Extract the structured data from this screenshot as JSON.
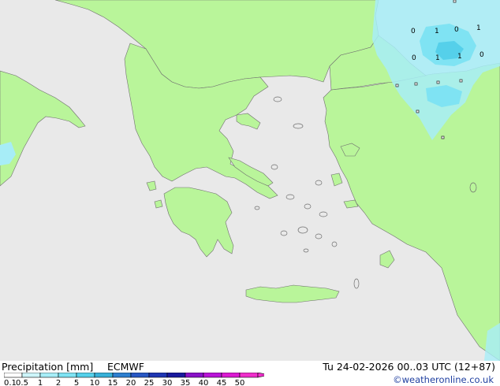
{
  "header": {
    "title": "Precipitation [mm]",
    "model": "ECMWF",
    "run": "Tu 24-02-2026 00..03 UTC (12+87)",
    "credit": "©weatheronline.co.uk"
  },
  "legend": {
    "ticks": [
      "0.1",
      "0.5",
      "1",
      "2",
      "5",
      "10",
      "15",
      "20",
      "25",
      "30",
      "35",
      "40",
      "45",
      "50"
    ],
    "colors": [
      "#ffffff",
      "#cdf5fa",
      "#a7edf7",
      "#7fe3f3",
      "#55d0ea",
      "#37b0d8",
      "#2d7fd0",
      "#2858c4",
      "#1f36b3",
      "#1a1a9e",
      "#8a12c8",
      "#b914d8",
      "#db1ad2",
      "#ef2ecb"
    ]
  },
  "map": {
    "sea_color": "#e9e9e9",
    "land_color": "#b9f59a",
    "coast_color": "#6f6f6f",
    "precip_colors": {
      "light": "#a7edf7",
      "medium": "#7fe3f3",
      "strong": "#55d0ea"
    },
    "contour_labels": [
      "1",
      "1",
      "1",
      "1",
      "0",
      "0",
      "0",
      "0"
    ]
  }
}
